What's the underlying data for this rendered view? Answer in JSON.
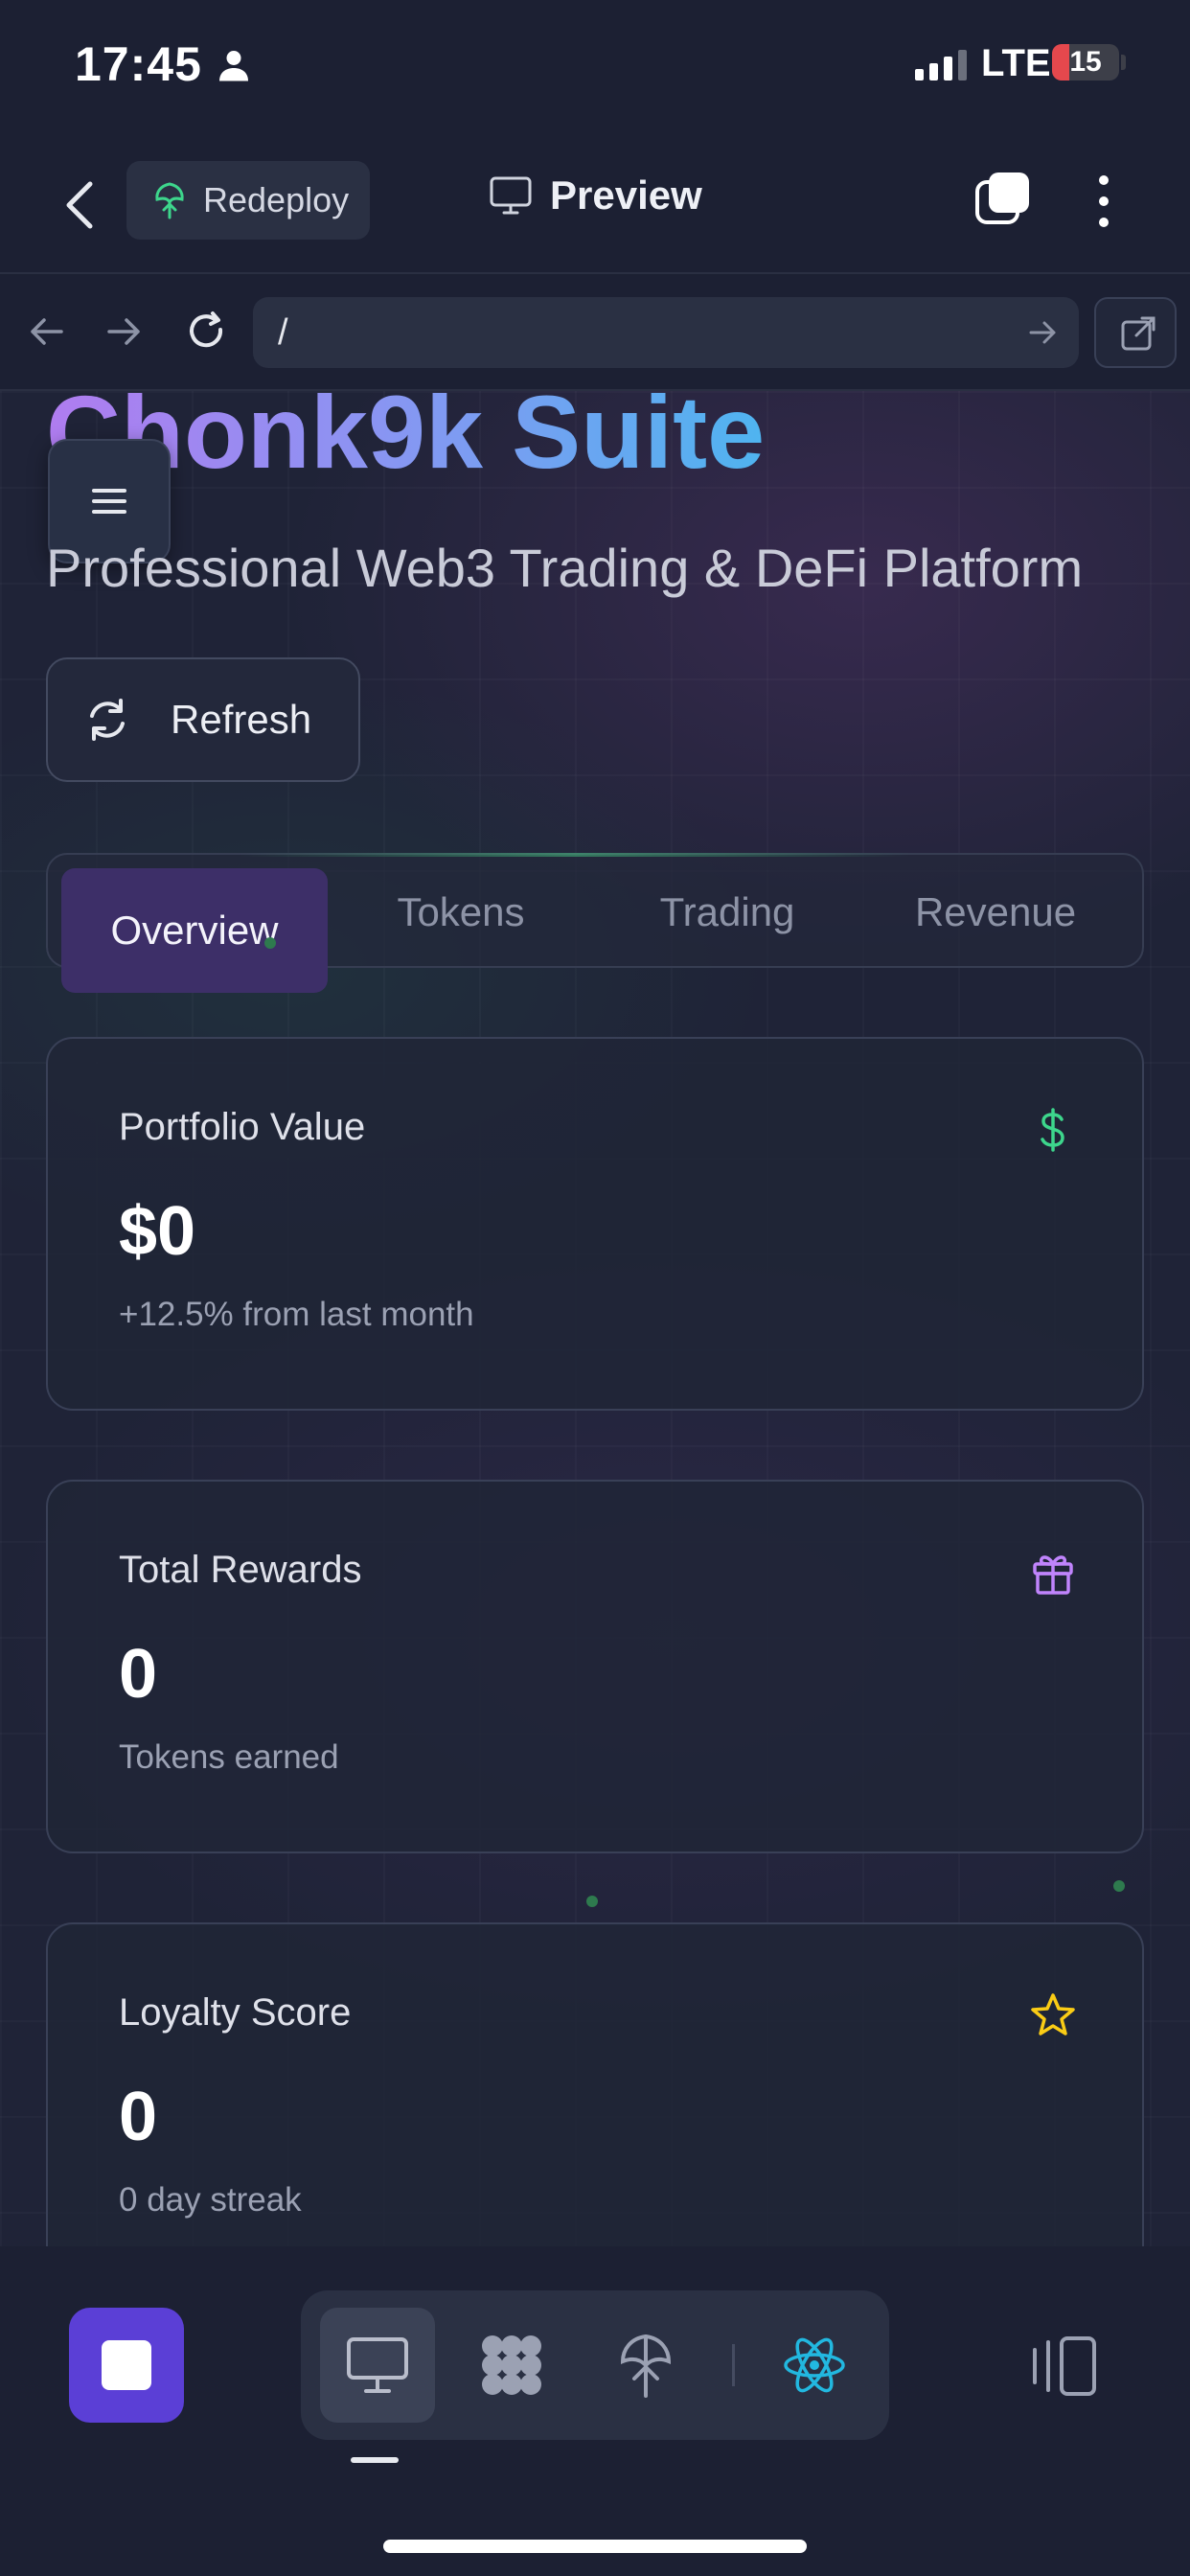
{
  "status_bar": {
    "time": "17:45",
    "network": "LTE",
    "battery": "15"
  },
  "header": {
    "redeploy_label": "Redeploy",
    "preview_label": "Preview"
  },
  "browser": {
    "url": "/"
  },
  "hero": {
    "title": "Chonk9k Suite",
    "subtitle": "Professional Web3 Trading & DeFi Platform",
    "refresh_label": "Refresh"
  },
  "tabs": [
    {
      "label": "Overview",
      "active": true
    },
    {
      "label": "Tokens",
      "active": false
    },
    {
      "label": "Trading",
      "active": false
    },
    {
      "label": "Revenue",
      "active": false
    }
  ],
  "cards": [
    {
      "label": "Portfolio Value",
      "value": "$0",
      "sub": "+12.5% from last month",
      "icon": "dollar-icon",
      "icon_color": "#3dd68c"
    },
    {
      "label": "Total Rewards",
      "value": "0",
      "sub": "Tokens earned",
      "icon": "gift-icon",
      "icon_color": "#c084fc"
    },
    {
      "label": "Loyalty Score",
      "value": "0",
      "sub": "0 day streak",
      "icon": "star-icon",
      "icon_color": "#facc15"
    }
  ],
  "colors": {
    "accent": "#5b3fd6",
    "active_tab": "#3d2f68",
    "react_icon": "#22b8e0"
  }
}
